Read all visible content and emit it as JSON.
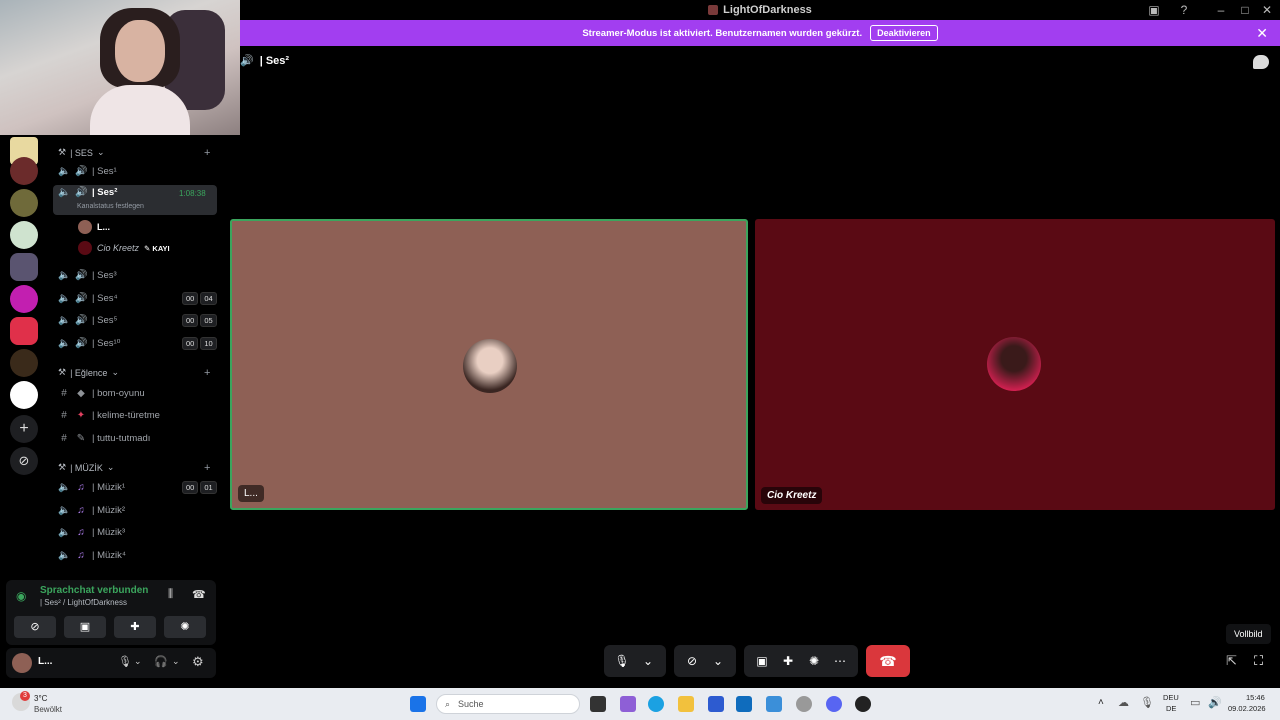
{
  "window": {
    "title": "LightOfDarkness"
  },
  "banner": {
    "text": "Streamer-Modus ist aktiviert. Benutzernamen wurden gekürzt.",
    "button": "Deaktivieren"
  },
  "voice_header": {
    "channel": "| Ses²"
  },
  "channels": {
    "cat_ses": "| SES",
    "ses1": "| Ses¹",
    "ses2": {
      "name": "| Ses²",
      "timer": "1:08:38",
      "status_hint": "Kanalstatus festlegen"
    },
    "users": [
      {
        "name": "L..."
      },
      {
        "name": "Cio Kreetz",
        "tag": "KAYI"
      }
    ],
    "ses3": "| Ses³",
    "ses4": {
      "name": "| Ses⁴",
      "b1": "00",
      "b2": "04"
    },
    "ses5": {
      "name": "| Ses⁵",
      "b1": "00",
      "b2": "05"
    },
    "ses10": {
      "name": "| Ses¹⁰",
      "b1": "00",
      "b2": "10"
    },
    "cat_eglence": "| Eğlence",
    "text1": "| bom-oyunu",
    "text2": "| kelime-türetme",
    "text3": "| tuttu-tutmadı",
    "cat_muzik": "| MÜZİK",
    "m1": {
      "name": "| Müzik¹",
      "b1": "00",
      "b2": "01"
    },
    "m2": "| Müzik²",
    "m3": "| Müzik³",
    "m4": "| Müzik⁴"
  },
  "voice_panel": {
    "status": "Sprachchat verbunden",
    "location": "| Ses² / LightOfDarkness"
  },
  "user_bar": {
    "name": "L..."
  },
  "tiles": [
    {
      "name": "L..."
    },
    {
      "name": "Cio Kreetz"
    }
  ],
  "tooltip": "Vollbild",
  "taskbar": {
    "weather_temp": "3°C",
    "weather_desc": "Bewölkt",
    "search_placeholder": "Suche",
    "lang": "DEU",
    "region": "DE",
    "time": "15:46",
    "date": "09.02.2026"
  },
  "colors": {
    "accent": "#a23ef0",
    "connected": "#3ba55d",
    "hangup": "#da373c"
  }
}
